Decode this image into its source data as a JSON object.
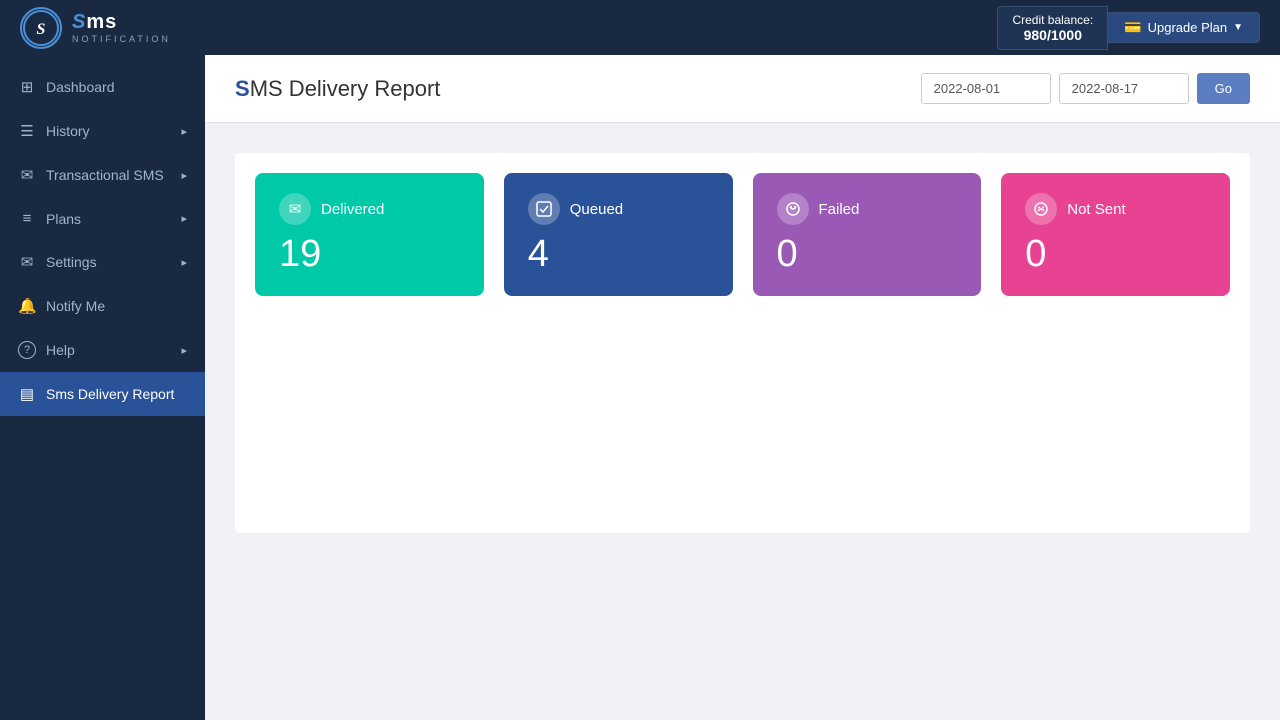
{
  "topBar": {
    "logoLetter": "S",
    "logoMain": "ms",
    "logoSub": "NOTIFICATION",
    "creditLabel": "Credit balance:",
    "creditAmount": "980/1000",
    "upgradeLabel": "Upgrade Plan"
  },
  "sidebar": {
    "items": [
      {
        "id": "dashboard",
        "label": "Dashboard",
        "icon": "⊞",
        "hasArrow": false,
        "active": false
      },
      {
        "id": "history",
        "label": "History",
        "icon": "☰",
        "hasArrow": true,
        "active": false
      },
      {
        "id": "transactional-sms",
        "label": "Transactional SMS",
        "icon": "✉",
        "hasArrow": true,
        "active": false
      },
      {
        "id": "plans",
        "label": "Plans",
        "icon": "≡",
        "hasArrow": true,
        "active": false
      },
      {
        "id": "settings",
        "label": "Settings",
        "icon": "✉",
        "hasArrow": true,
        "active": false
      },
      {
        "id": "notify-me",
        "label": "Notify Me",
        "icon": "🔔",
        "hasArrow": false,
        "active": false
      },
      {
        "id": "help",
        "label": "Help",
        "icon": "?",
        "hasArrow": true,
        "active": false
      },
      {
        "id": "sms-delivery-report",
        "label": "Sms Delivery Report",
        "icon": "▤",
        "hasArrow": false,
        "active": true
      }
    ]
  },
  "pageHeader": {
    "titleHighlight": "S",
    "titleRest": "MS Delivery Report",
    "dateFrom": "2022-08-01",
    "dateTo": "2022-08-17",
    "goLabel": "Go"
  },
  "cards": [
    {
      "id": "delivered",
      "label": "Delivered",
      "value": "19",
      "colorClass": "card-delivered",
      "icon": "✉"
    },
    {
      "id": "queued",
      "label": "Queued",
      "value": "4",
      "colorClass": "card-queued",
      "icon": "✓"
    },
    {
      "id": "failed",
      "label": "Failed",
      "value": "0",
      "colorClass": "card-failed",
      "icon": "🛒"
    },
    {
      "id": "not-sent",
      "label": "Not Sent",
      "value": "0",
      "colorClass": "card-not-sent",
      "icon": "🛒"
    }
  ]
}
